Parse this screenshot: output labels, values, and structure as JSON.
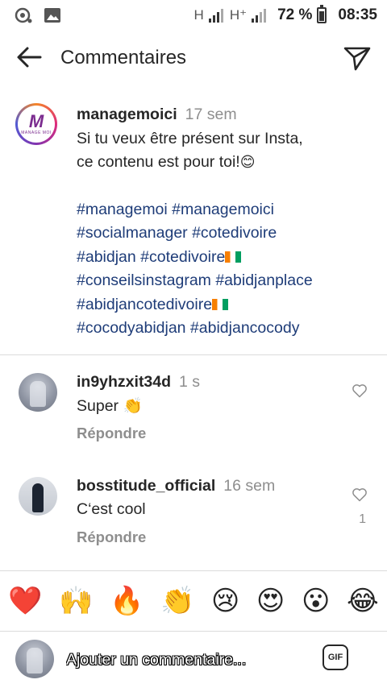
{
  "status_bar": {
    "network_1": "H",
    "network_2": "H⁺",
    "battery_percent": "72 %",
    "battery_level": 0.72,
    "time": "08:35"
  },
  "header": {
    "title": "Commentaires",
    "back_icon": "arrow-left-icon",
    "send_icon": "paper-plane-icon"
  },
  "post": {
    "username": "managemoici",
    "time": "17 sem",
    "text_line1": "Si tu veux être présent sur Insta,",
    "text_line2": "ce contenu est pour toi!",
    "text_emoji": "😊",
    "hashtags": [
      "#managemoi #managemoici",
      "#socialmanager #cotedivoire",
      "#abidjan #cotedivoire",
      "#conseilsinstagram #abidjanplace",
      "#abidjancotedivoire",
      "#cocodyabidjan #abidjancocody"
    ],
    "avatar_logo": "M",
    "avatar_logo_text": "MANAGE MOI"
  },
  "comments": [
    {
      "username": "in9yhzxit34d",
      "time": "1 s",
      "text": "Super 👏",
      "reply_label": "Répondre",
      "likes": ""
    },
    {
      "username": "bosstitude_official",
      "time": "16 sem",
      "text": "C‘est cool",
      "reply_label": "Répondre",
      "likes": "1"
    }
  ],
  "emoji_bar": [
    "❤️",
    "🙌",
    "🔥",
    "👏",
    "😢",
    "😍",
    "😮",
    "😂"
  ],
  "composer": {
    "placeholder": "Ajouter un commentaire...",
    "gif_label": "GIF"
  },
  "colors": {
    "hashtag": "#1e3c78",
    "muted": "#8e8e8e",
    "divider": "#dbdbdb",
    "text": "#262626"
  }
}
